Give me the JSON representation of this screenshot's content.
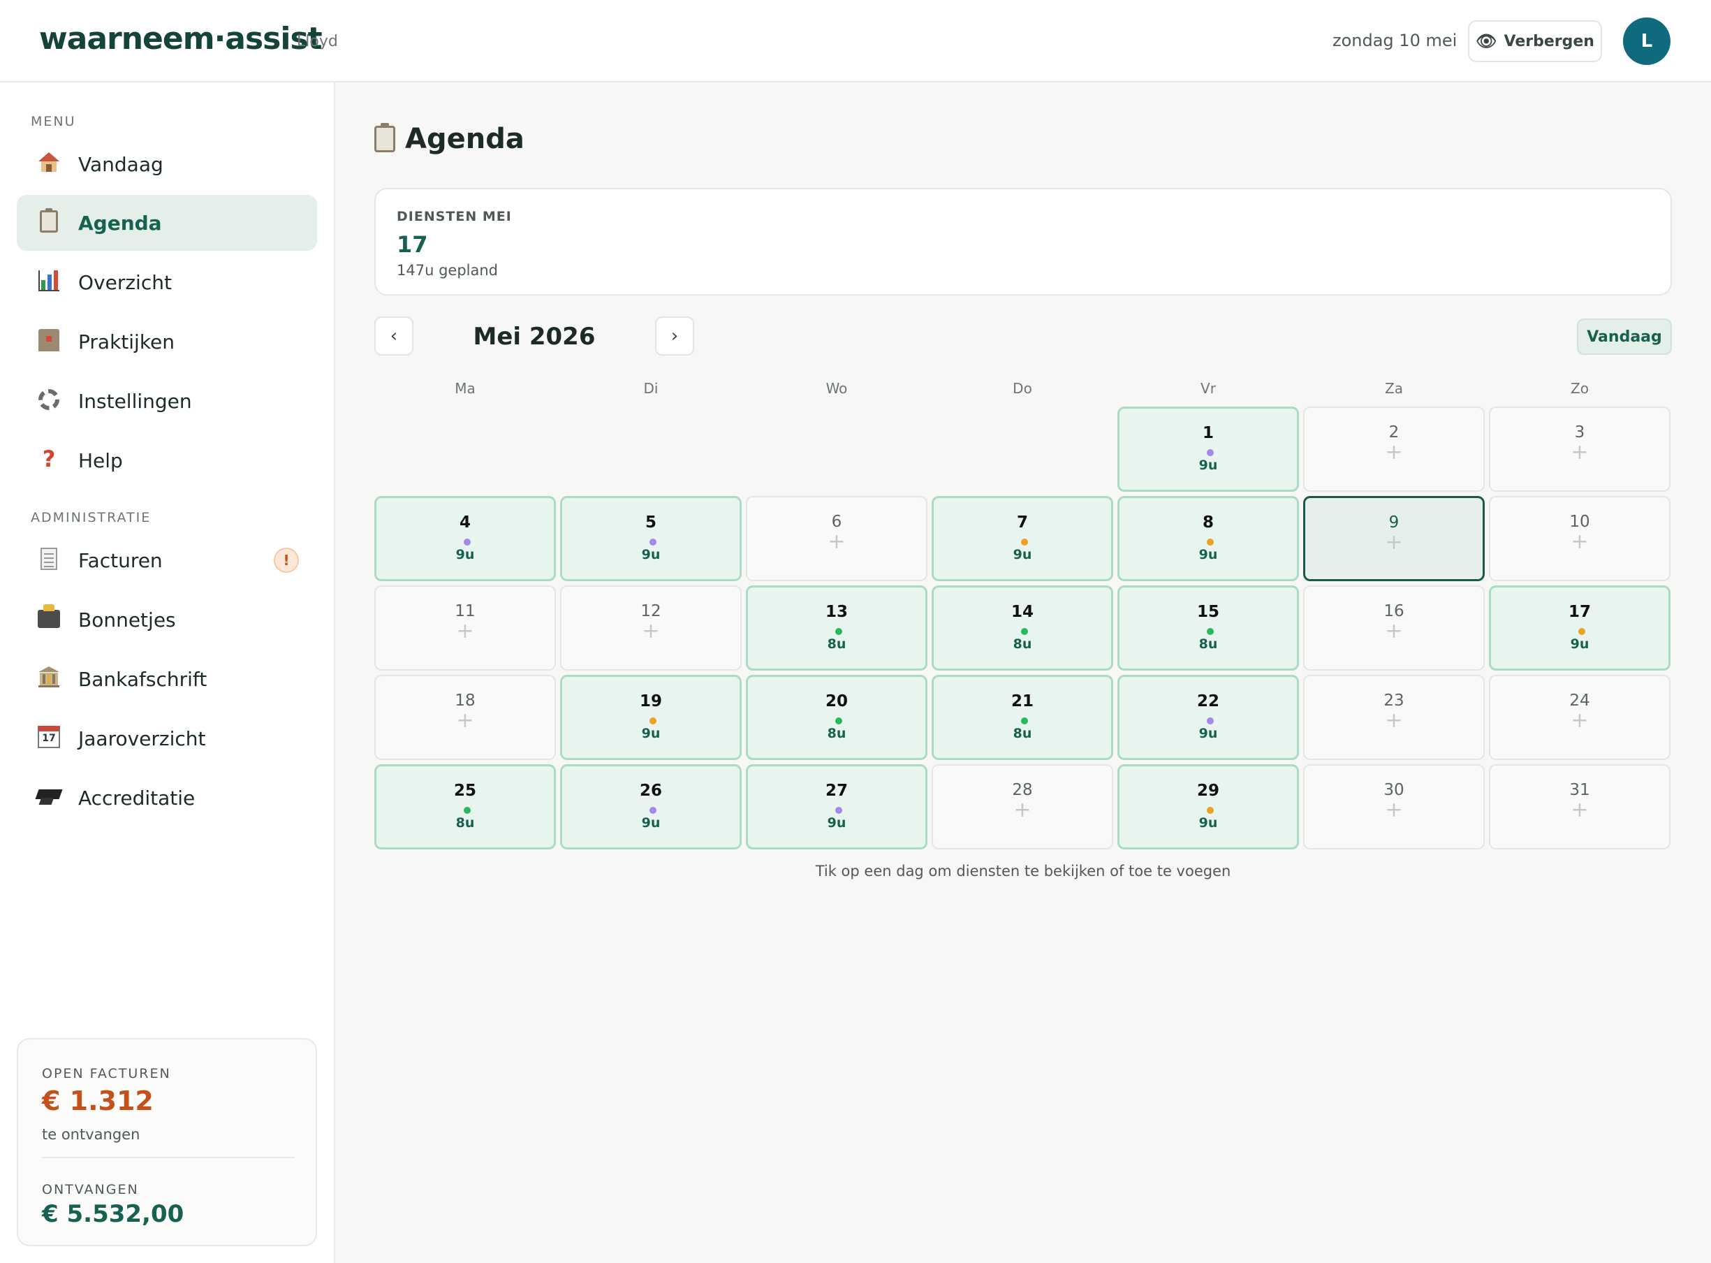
{
  "header": {
    "brand": "waarneem·assist",
    "user": "Lloyd",
    "date": "zondag 10 mei",
    "hide_label": "Verbergen",
    "avatar_initial": "L"
  },
  "sidebar": {
    "menu_label": "MENU",
    "admin_label": "ADMINISTRATIE",
    "menu_items": [
      {
        "label": "Vandaag",
        "icon": "house-icon"
      },
      {
        "label": "Agenda",
        "icon": "clipboard-icon",
        "active": true
      },
      {
        "label": "Overzicht",
        "icon": "bar-chart-icon"
      },
      {
        "label": "Praktijken",
        "icon": "hospital-icon"
      },
      {
        "label": "Instellingen",
        "icon": "gear-icon"
      },
      {
        "label": "Help",
        "icon": "question-icon"
      }
    ],
    "admin_items": [
      {
        "label": "Facturen",
        "icon": "receipt-icon",
        "badge": "!"
      },
      {
        "label": "Bonnetjes",
        "icon": "camera-icon"
      },
      {
        "label": "Bankafschrift",
        "icon": "bank-icon"
      },
      {
        "label": "Jaaroverzicht",
        "icon": "calendar-icon",
        "icon_text": "17"
      },
      {
        "label": "Accreditatie",
        "icon": "graduation-cap-icon"
      }
    ],
    "card": {
      "open_label": "OPEN FACTUREN",
      "open_value": "€ 1.312",
      "open_sub": "te ontvangen",
      "received_label": "ONTVANGEN",
      "received_value": "€ 5.532,00"
    }
  },
  "main": {
    "title": "Agenda",
    "summary": {
      "label": "DIENSTEN MEI",
      "value": "17",
      "sub": "147u gepland"
    },
    "month": "Mei 2026",
    "prev": "‹",
    "next": "›",
    "today_btn": "Vandaag",
    "weekdays": [
      "Ma",
      "Di",
      "Wo",
      "Do",
      "Vr",
      "Za",
      "Zo"
    ],
    "first_weekday_index": 4,
    "today_day": 9,
    "days": [
      {
        "d": "1",
        "hrs": "9u",
        "dot": "purple"
      },
      {
        "d": "2"
      },
      {
        "d": "3"
      },
      {
        "d": "4",
        "hrs": "9u",
        "dot": "purple"
      },
      {
        "d": "5",
        "hrs": "9u",
        "dot": "purple"
      },
      {
        "d": "6"
      },
      {
        "d": "7",
        "hrs": "9u",
        "dot": "orange"
      },
      {
        "d": "8",
        "hrs": "9u",
        "dot": "orange"
      },
      {
        "d": "9"
      },
      {
        "d": "10"
      },
      {
        "d": "11"
      },
      {
        "d": "12"
      },
      {
        "d": "13",
        "hrs": "8u",
        "dot": "green"
      },
      {
        "d": "14",
        "hrs": "8u",
        "dot": "green"
      },
      {
        "d": "15",
        "hrs": "8u",
        "dot": "green"
      },
      {
        "d": "16"
      },
      {
        "d": "17",
        "hrs": "9u",
        "dot": "orange"
      },
      {
        "d": "18"
      },
      {
        "d": "19",
        "hrs": "9u",
        "dot": "orange"
      },
      {
        "d": "20",
        "hrs": "8u",
        "dot": "green"
      },
      {
        "d": "21",
        "hrs": "8u",
        "dot": "green"
      },
      {
        "d": "22",
        "hrs": "9u",
        "dot": "purple"
      },
      {
        "d": "23"
      },
      {
        "d": "24"
      },
      {
        "d": "25",
        "hrs": "8u",
        "dot": "green"
      },
      {
        "d": "26",
        "hrs": "9u",
        "dot": "purple"
      },
      {
        "d": "27",
        "hrs": "9u",
        "dot": "purple"
      },
      {
        "d": "28"
      },
      {
        "d": "29",
        "hrs": "9u",
        "dot": "orange"
      },
      {
        "d": "30"
      },
      {
        "d": "31"
      }
    ],
    "plus": "+",
    "hint": "Tik op een dag om diensten te bekijken of toe te voegen"
  },
  "colors": {
    "brand": "#14433a",
    "accent": "#16614f",
    "purple": "#a48ae6",
    "orange": "#eaa221",
    "green": "#2cb55d",
    "open_amount": "#c4511a",
    "received_amount": "#16614f"
  }
}
